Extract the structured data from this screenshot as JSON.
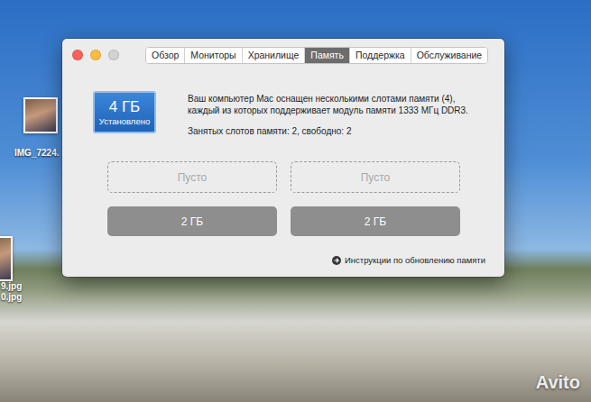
{
  "desktop": {
    "icons": [
      {
        "label": "IMG_7224."
      },
      {
        "label": "9.jpg"
      },
      {
        "label": "0.jpg"
      }
    ],
    "watermark": "Avito"
  },
  "window": {
    "traffic_lights": [
      {
        "color": "#fc605b"
      },
      {
        "color": "#fdbc40"
      },
      {
        "color": "#d3d3d3"
      }
    ],
    "tabs": [
      {
        "label": "Обзор",
        "selected": false
      },
      {
        "label": "Мониторы",
        "selected": false
      },
      {
        "label": "Хранилище",
        "selected": false
      },
      {
        "label": "Память",
        "selected": true
      },
      {
        "label": "Поддержка",
        "selected": false
      },
      {
        "label": "Обслуживание",
        "selected": false
      }
    ]
  },
  "summary": {
    "amount": "4 ГБ",
    "caption": "Установлено"
  },
  "description": "Ваш компьютер Mac оснащен несколькими слотами памяти (4), каждый из которых поддерживает модуль памяти 1333 МГц DDR3.",
  "occupancy": "Занятых слотов памяти: 2, свободно: 2",
  "slots": [
    {
      "label": "Пусто",
      "installed": false
    },
    {
      "label": "Пусто",
      "installed": false
    },
    {
      "label": "2 ГБ",
      "installed": true
    },
    {
      "label": "2 ГБ",
      "installed": true
    }
  ],
  "link": "Инструкции по обновлению памяти"
}
